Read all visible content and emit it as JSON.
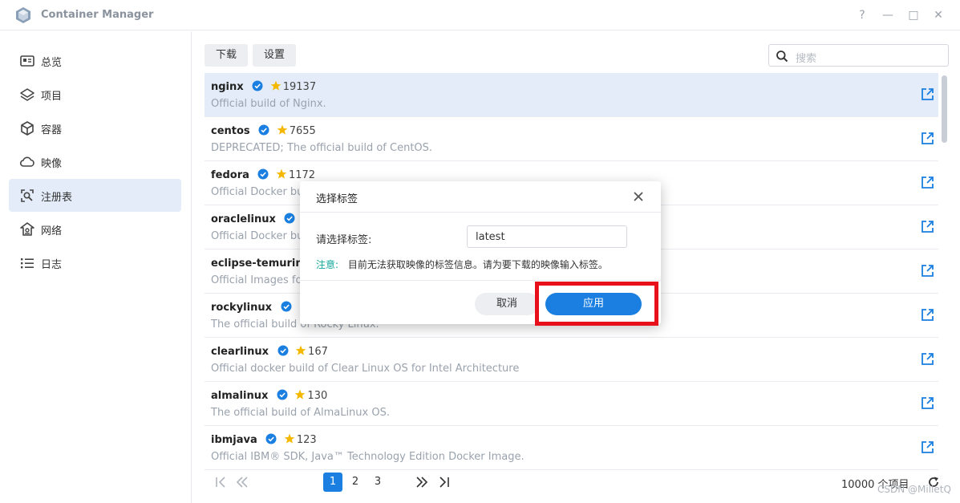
{
  "app": {
    "title": "Container Manager"
  },
  "window_controls": {
    "help": "?",
    "minimize": "—",
    "maximize": "□",
    "close": "✕"
  },
  "sidebar": {
    "items": [
      {
        "label": "总览",
        "icon": "overview-icon"
      },
      {
        "label": "项目",
        "icon": "layers-icon"
      },
      {
        "label": "容器",
        "icon": "cube-icon"
      },
      {
        "label": "映像",
        "icon": "cloud-icon"
      },
      {
        "label": "注册表",
        "icon": "registry-icon",
        "active": true
      },
      {
        "label": "网络",
        "icon": "network-icon"
      },
      {
        "label": "日志",
        "icon": "log-icon"
      }
    ]
  },
  "toolbar": {
    "download_label": "下载",
    "settings_label": "设置",
    "search_placeholder": "搜索"
  },
  "registry": {
    "rows": [
      {
        "name": "nginx",
        "stars": "19137",
        "desc": "Official build of Nginx."
      },
      {
        "name": "centos",
        "stars": "7655",
        "desc": "DEPRECATED; The official build of CentOS."
      },
      {
        "name": "fedora",
        "stars": "1172",
        "desc": "Official Docker bu"
      },
      {
        "name": "oraclelinux",
        "stars": "",
        "desc": "Official Docker bu"
      },
      {
        "name": "eclipse-temurin",
        "stars": "",
        "desc": "Official Images fo"
      },
      {
        "name": "rockylinux",
        "stars": "",
        "desc": "The official build of Rocky Linux."
      },
      {
        "name": "clearlinux",
        "stars": "167",
        "desc": "Official docker build of Clear Linux OS for Intel Architecture"
      },
      {
        "name": "almalinux",
        "stars": "130",
        "desc": "The official build of AlmaLinux OS."
      },
      {
        "name": "ibmjava",
        "stars": "123",
        "desc": "Official IBM® SDK, Java™ Technology Edition Docker Image."
      }
    ]
  },
  "pagination": {
    "pages": [
      "1",
      "2",
      "3"
    ],
    "current": "1",
    "total_label": "10000 个项目"
  },
  "watermark": "CSDN @MilletQ",
  "dialog": {
    "title": "选择标签",
    "field_label": "请选择标签:",
    "field_value": "latest",
    "note_key": "注意:",
    "note_text": "目前无法获取映像的标签信息。请为要下载的映像输入标签。",
    "cancel_label": "取消",
    "apply_label": "应用"
  },
  "colors": {
    "accent": "#1a7fe0",
    "highlight": "#e8101a",
    "note": "#12a59a",
    "selected_row": "#e3ecf8"
  }
}
